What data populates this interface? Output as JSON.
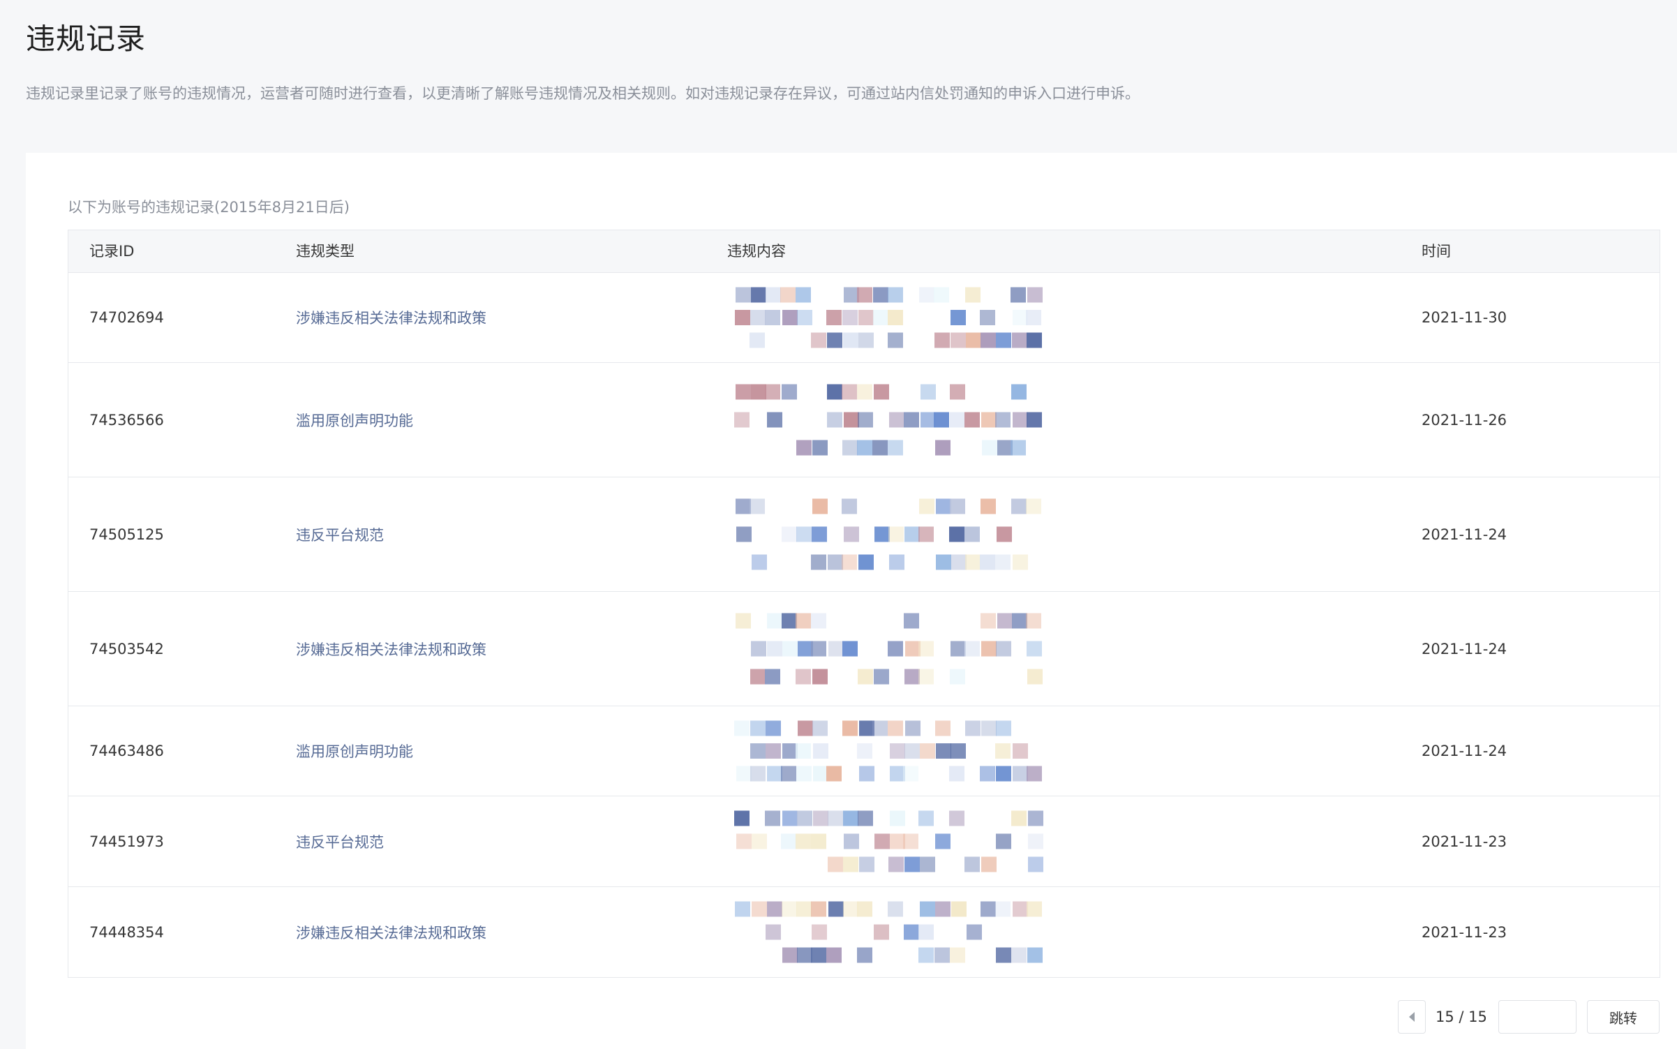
{
  "page": {
    "title": "违规记录",
    "description": "违规记录里记录了账号的违规情况，运营者可随时进行查看，以更清晰了解账号违规情况及相关规则。如对违规记录存在异议，可通过站内信处罚通知的申诉入口进行申诉。"
  },
  "records": {
    "subtitle": "以下为账号的违规记录(2015年8月21日后)",
    "columns": {
      "id": "记录ID",
      "type": "违规类型",
      "content": "违规内容",
      "time": "时间"
    },
    "rows": [
      {
        "id": "74702694",
        "type": "涉嫌违反相关法律法规和政策",
        "time": "2021-11-30"
      },
      {
        "id": "74536566",
        "type": "滥用原创声明功能",
        "time": "2021-11-26"
      },
      {
        "id": "74505125",
        "type": "违反平台规范",
        "time": "2021-11-24"
      },
      {
        "id": "74503542",
        "type": "涉嫌违反相关法律法规和政策",
        "time": "2021-11-24"
      },
      {
        "id": "74463486",
        "type": "滥用原创声明功能",
        "time": "2021-11-24"
      },
      {
        "id": "74451973",
        "type": "违反平台规范",
        "time": "2021-11-23"
      },
      {
        "id": "74448354",
        "type": "涉嫌违反相关法律法规和政策",
        "time": "2021-11-23"
      }
    ]
  },
  "pagination": {
    "current": "15 / 15",
    "input_value": "",
    "jump_label": "跳转",
    "prev_icon": "caret-left-icon"
  },
  "colors": {
    "link": "#576b95",
    "text": "#353535",
    "muted": "#8a8f99",
    "background": "#f6f7f9",
    "mosaic_palette": [
      "#5a6fa6",
      "#8a99c2",
      "#b9c3dc",
      "#dfe6f4",
      "#c28e98",
      "#e9b9a3",
      "#8fb3e0",
      "#6b8fd1",
      "#f3e9c9",
      "#e9f6fb",
      "#a897b8"
    ]
  }
}
